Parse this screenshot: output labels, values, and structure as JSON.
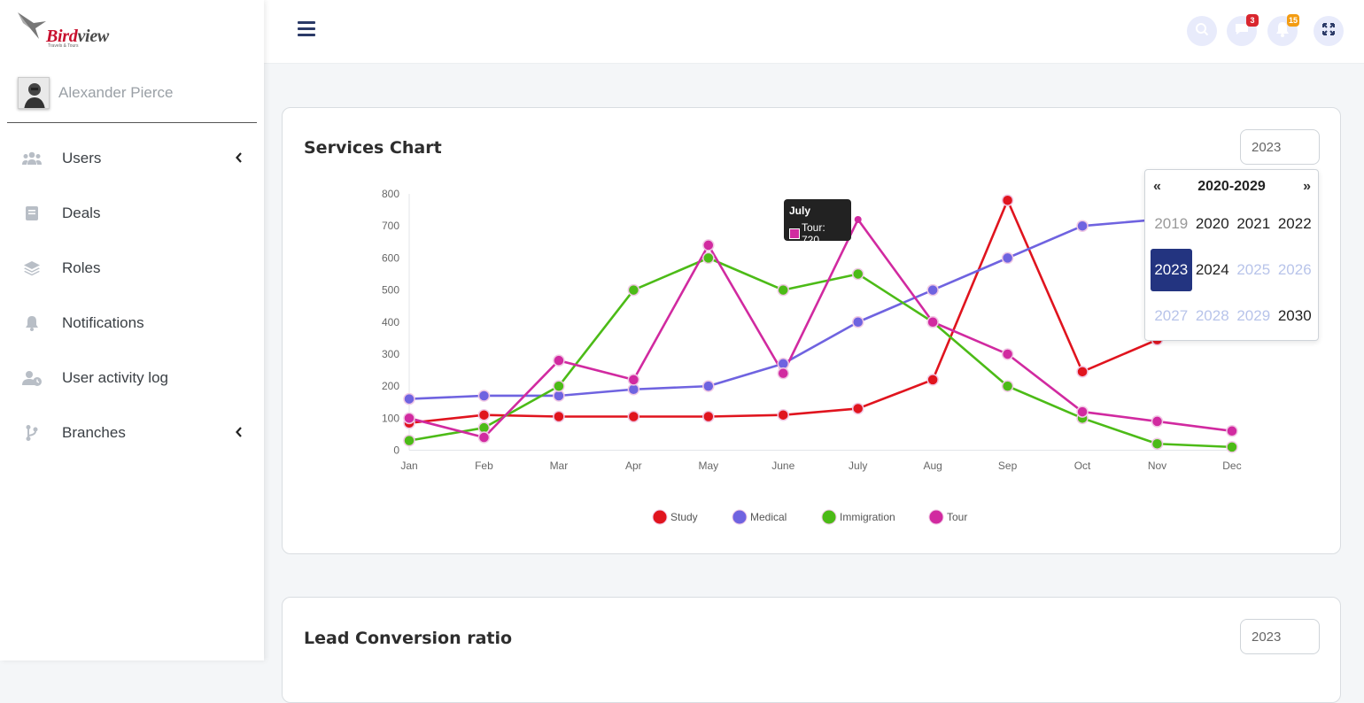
{
  "brand": {
    "name_bold": "Bird",
    "name_rest": "view",
    "tagline": "Travels & Tours"
  },
  "user": {
    "name": "Alexander Pierce"
  },
  "sidebar": {
    "items": [
      {
        "label": "Users",
        "icon": "users-icon",
        "has_submenu": true
      },
      {
        "label": "Deals",
        "icon": "book-icon",
        "has_submenu": false
      },
      {
        "label": "Roles",
        "icon": "layers-icon",
        "has_submenu": false
      },
      {
        "label": "Notifications",
        "icon": "bell-icon",
        "has_submenu": false
      },
      {
        "label": "User activity log",
        "icon": "user-clock-icon",
        "has_submenu": false
      },
      {
        "label": "Branches",
        "icon": "branch-icon",
        "has_submenu": true
      }
    ]
  },
  "topbar": {
    "messages_count": "3",
    "notifications_count": "15",
    "colors": {
      "messages_badge": "#d9262e",
      "notifications_badge": "#f39c12"
    }
  },
  "services_card": {
    "title": "Services Chart",
    "year_value": "2023",
    "tooltip": {
      "title": "July",
      "text": "Tour: 720"
    }
  },
  "datepicker": {
    "prev": "«",
    "next": "»",
    "range": "2020-2029",
    "years": [
      {
        "label": "2019",
        "state": "old"
      },
      {
        "label": "2020",
        "state": ""
      },
      {
        "label": "2021",
        "state": ""
      },
      {
        "label": "2022",
        "state": ""
      },
      {
        "label": "2023",
        "state": "active"
      },
      {
        "label": "2024",
        "state": ""
      },
      {
        "label": "2025",
        "state": "future"
      },
      {
        "label": "2026",
        "state": "future"
      },
      {
        "label": "2027",
        "state": "future"
      },
      {
        "label": "2028",
        "state": "future"
      },
      {
        "label": "2029",
        "state": "future"
      },
      {
        "label": "2030",
        "state": ""
      }
    ]
  },
  "lead_card": {
    "title": "Lead Conversion ratio",
    "year_value": "2023"
  },
  "chart_data": {
    "type": "line",
    "categories": [
      "Jan",
      "Feb",
      "Mar",
      "Apr",
      "May",
      "June",
      "July",
      "Aug",
      "Sep",
      "Oct",
      "Nov",
      "Dec"
    ],
    "ylim": [
      0,
      800
    ],
    "yticks": [
      0,
      100,
      200,
      300,
      400,
      500,
      600,
      700,
      800
    ],
    "legend_position": "bottom",
    "series": [
      {
        "name": "Study",
        "color": "#e0141e",
        "values": [
          85,
          110,
          105,
          105,
          105,
          110,
          130,
          220,
          780,
          245,
          345,
          null
        ]
      },
      {
        "name": "Medical",
        "color": "#6f63e0",
        "values": [
          160,
          170,
          170,
          190,
          200,
          270,
          400,
          500,
          600,
          700,
          720,
          null
        ]
      },
      {
        "name": "Immigration",
        "color": "#4cbb17",
        "values": [
          30,
          70,
          200,
          500,
          600,
          500,
          550,
          400,
          200,
          100,
          20,
          10
        ]
      },
      {
        "name": "Tour",
        "color": "#d12aa0",
        "values": [
          100,
          40,
          280,
          220,
          640,
          240,
          720,
          400,
          300,
          120,
          90,
          60
        ]
      }
    ]
  }
}
